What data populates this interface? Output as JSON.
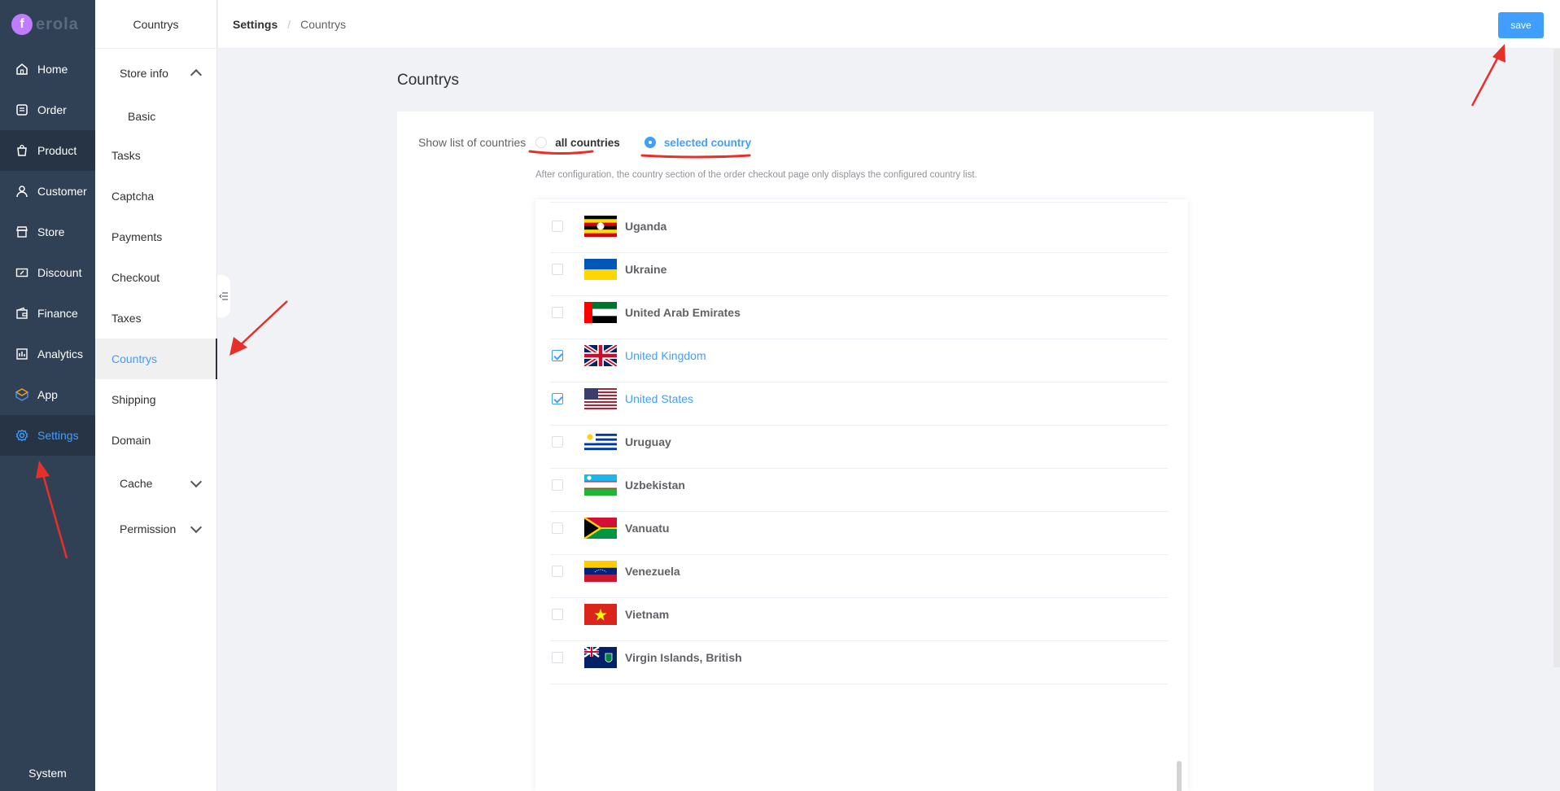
{
  "app": {
    "logo_text": "erola"
  },
  "sidebar": {
    "items": [
      {
        "label": "Home",
        "icon": "home-icon"
      },
      {
        "label": "Order",
        "icon": "order-icon"
      },
      {
        "label": "Product",
        "icon": "bag-icon"
      },
      {
        "label": "Customer",
        "icon": "user-icon"
      },
      {
        "label": "Store",
        "icon": "store-icon"
      },
      {
        "label": "Discount",
        "icon": "ticket-icon"
      },
      {
        "label": "Finance",
        "icon": "wallet-icon"
      },
      {
        "label": "Analytics",
        "icon": "chart-icon"
      },
      {
        "label": "App",
        "icon": "cube-icon"
      },
      {
        "label": "Settings",
        "icon": "gear-icon"
      }
    ],
    "system": "System"
  },
  "submenu": {
    "title": "Countrys",
    "store_info": "Store info",
    "basic": "Basic",
    "tasks": "Tasks",
    "captcha": "Captcha",
    "payments": "Payments",
    "checkout": "Checkout",
    "taxes": "Taxes",
    "countrys": "Countrys",
    "shipping": "Shipping",
    "domain": "Domain",
    "cache": "Cache",
    "permission": "Permission"
  },
  "breadcrumb": {
    "parent": "Settings",
    "separator": "/",
    "current": "Countrys"
  },
  "toolbar": {
    "save_label": "save"
  },
  "page": {
    "title": "Countrys",
    "show_list_label": "Show list of countries",
    "option_all": "all countries",
    "option_selected": "selected country",
    "hint": "After configuration, the country section of the order checkout page only displays the configured country list."
  },
  "countries": [
    {
      "name": "Uganda",
      "checked": false
    },
    {
      "name": "Ukraine",
      "checked": false
    },
    {
      "name": "United Arab Emirates",
      "checked": false
    },
    {
      "name": "United Kingdom",
      "checked": true
    },
    {
      "name": "United States",
      "checked": true
    },
    {
      "name": "Uruguay",
      "checked": false
    },
    {
      "name": "Uzbekistan",
      "checked": false
    },
    {
      "name": "Vanuatu",
      "checked": false
    },
    {
      "name": "Venezuela",
      "checked": false
    },
    {
      "name": "Vietnam",
      "checked": false
    },
    {
      "name": "Virgin Islands, British",
      "checked": false
    }
  ],
  "colors": {
    "accent": "#409eff",
    "sidebar_bg": "#304156",
    "annotation": "#e8302a"
  }
}
